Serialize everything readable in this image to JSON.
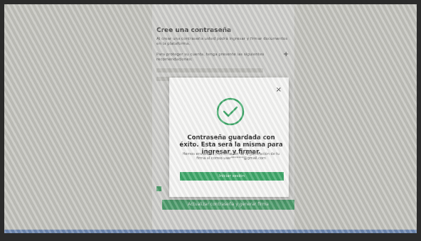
{
  "page": {
    "title": "Cree una contraseña",
    "intro": "Al crear una contraseña usted podrá ingresar y firmar documentos en la plataforma.",
    "field_label": "Para proteger su cuenta, tenga presente las siguientes recomendaciones:",
    "submit_label": "Actualizar contraseña y generar firma"
  },
  "modal": {
    "title": "Contraseña guardada con éxito. Esta será la misma para ingresar y firmar.",
    "body": "Hemos enviado la confirmación de la generación de tu firma al correo user*******@gmail.com",
    "button_label": "Iniciar sesión",
    "close_icon": "close-icon",
    "success_icon": "check-circle-icon"
  },
  "colors": {
    "accent": "#3fa86a"
  }
}
